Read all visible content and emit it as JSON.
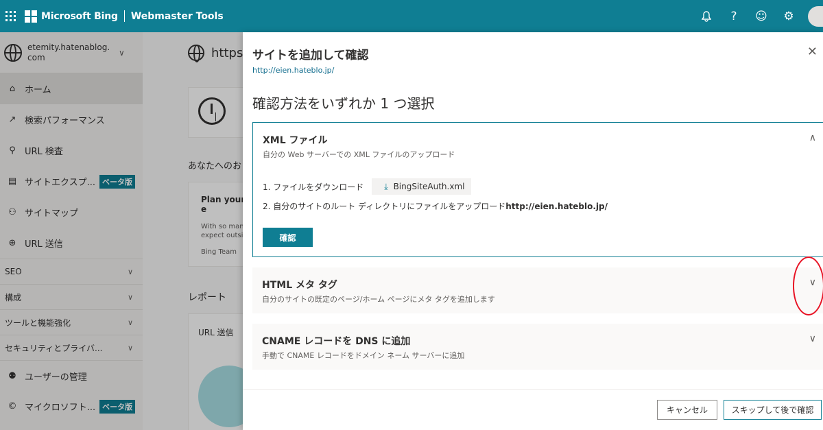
{
  "topbar": {
    "brand": "Microsoft Bing",
    "product": "Webmaster Tools",
    "icons": [
      "bell-icon",
      "help-icon",
      "smiley-icon",
      "gear-icon"
    ]
  },
  "sidebar": {
    "site": "etemity.hatenablog.com",
    "items": [
      {
        "label": "ホーム",
        "icon": "home-icon"
      },
      {
        "label": "検索パフォーマンス",
        "icon": "trend-icon"
      },
      {
        "label": "URL 検査",
        "icon": "search-icon"
      },
      {
        "label": "サイトエクスプ...",
        "icon": "document-icon",
        "badge": "ベータ版"
      },
      {
        "label": "サイトマップ",
        "icon": "sitemap-icon"
      },
      {
        "label": "URL 送信",
        "icon": "globe-icon"
      }
    ],
    "groups": [
      "SEO",
      "構成",
      "ツールと機能強化",
      "セキュリティとプライバ..."
    ],
    "bottom_items": [
      {
        "label": "ユーザーの管理",
        "icon": "user-icon"
      },
      {
        "label": "マイクロソフト...",
        "icon": "copyright-icon",
        "badge": "ベータ版"
      }
    ]
  },
  "background": {
    "url": "https:/",
    "section1": "あなたへのお",
    "card_title": "Plan your e",
    "card_text": "With so man expect outsic",
    "card_source": "Bing Team",
    "reports": "レポート",
    "report_item": "URL 送信"
  },
  "panel": {
    "title": "サイトを追加して確認",
    "url": "http://eien.hateblo.jp/",
    "heading": "確認方法をいずれか 1 つ選択",
    "xml": {
      "title": "XML ファイル",
      "subtitle": "自分の Web サーバーでの XML ファイルのアップロード",
      "step1": "1. ファイルをダウンロード",
      "download": "BingSiteAuth.xml",
      "step2_prefix": "2. 自分のサイトのルート ディレクトリにファイルをアップロード",
      "step2_url": "http://eien.hateblo.jp/",
      "confirm": "確認"
    },
    "html": {
      "title": "HTML メタ タグ",
      "subtitle": "自分のサイトの既定のページ/ホーム ページにメタ タグを追加します"
    },
    "cname": {
      "title": "CNAME レコードを DNS に追加",
      "subtitle": "手動で CNAME レコードをドメイン ネーム サーバーに追加"
    },
    "cancel": "キャンセル",
    "skip": "スキップして後で確認"
  },
  "colors": {
    "accent": "#0f7e93",
    "annotation": "#e81123"
  }
}
